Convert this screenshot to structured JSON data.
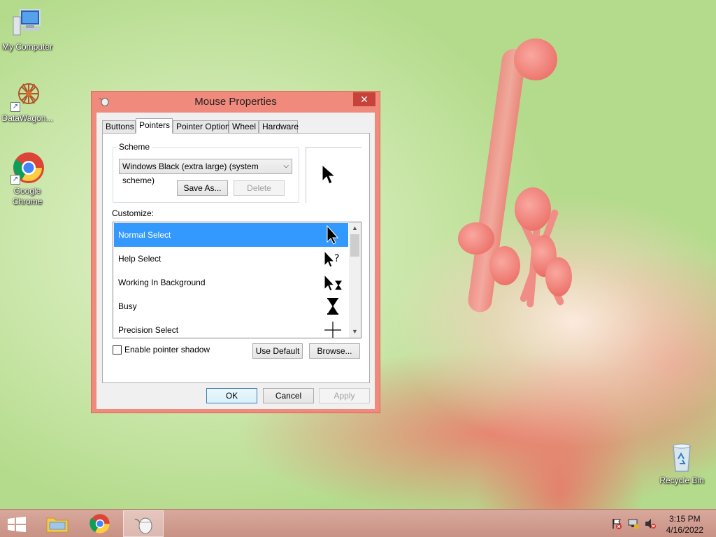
{
  "desktop": {
    "icons": [
      {
        "label": "My Computer",
        "icon": "computer-icon"
      },
      {
        "label": "DataWagon...",
        "icon": "datawagon-icon"
      },
      {
        "label": "Google Chrome",
        "icon": "chrome-icon"
      },
      {
        "label": "Recycle Bin",
        "icon": "recycle-bin-icon"
      }
    ]
  },
  "window": {
    "title": "Mouse Properties",
    "close": "✕",
    "tabs": [
      "Buttons",
      "Pointers",
      "Pointer Options",
      "Wheel",
      "Hardware"
    ],
    "active_tab": "Pointers",
    "scheme": {
      "group_label": "Scheme",
      "selected": "Windows Black (extra large) (system scheme)",
      "save_as": "Save As...",
      "delete": "Delete"
    },
    "customize_label": "Customize:",
    "cursor_list": [
      {
        "label": "Normal Select",
        "icon": "arrow-cursor-icon",
        "selected": true
      },
      {
        "label": "Help Select",
        "icon": "help-cursor-icon"
      },
      {
        "label": "Working In Background",
        "icon": "working-cursor-icon"
      },
      {
        "label": "Busy",
        "icon": "hourglass-icon"
      },
      {
        "label": "Precision Select",
        "icon": "crosshair-icon"
      }
    ],
    "shadow_label": "Enable pointer shadow",
    "shadow_checked": false,
    "use_default": "Use Default",
    "browse": "Browse...",
    "ok": "OK",
    "cancel": "Cancel",
    "apply": "Apply"
  },
  "taskbar": {
    "time": "3:15 PM",
    "date": "4/16/2022"
  }
}
